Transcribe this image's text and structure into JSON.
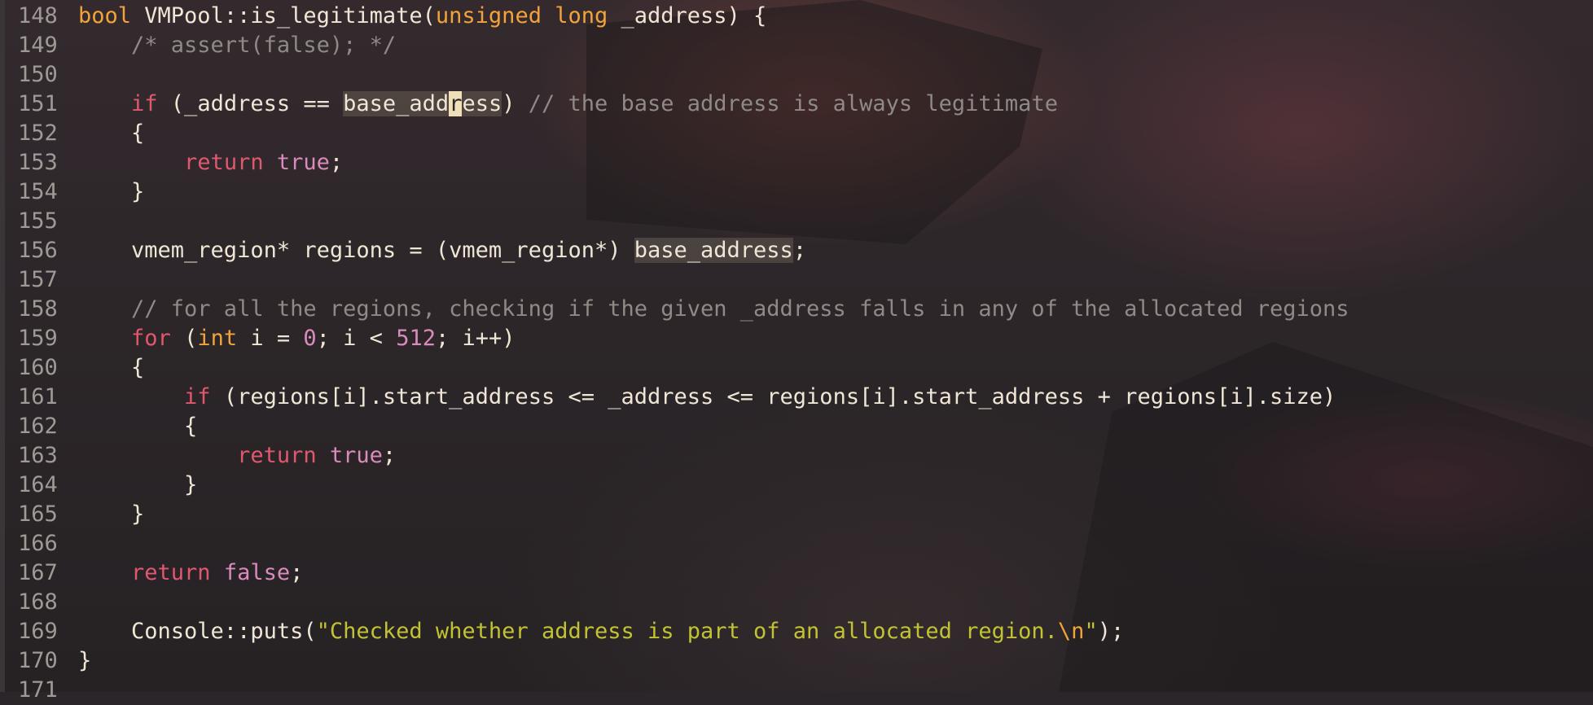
{
  "editor": {
    "lines": [
      {
        "n": "148",
        "tokens": [
          {
            "t": "bool",
            "c": "kw"
          },
          {
            "t": " VMPool::is_legitimate(",
            "c": "pl"
          },
          {
            "t": "unsigned",
            "c": "kw"
          },
          {
            "t": " ",
            "c": "pl"
          },
          {
            "t": "long",
            "c": "kw"
          },
          {
            "t": " _address) {",
            "c": "pl"
          }
        ]
      },
      {
        "n": "149",
        "tokens": [
          {
            "t": "    /* assert(false); */",
            "c": "cm"
          }
        ]
      },
      {
        "n": "150",
        "tokens": []
      },
      {
        "n": "151",
        "tokens": [
          {
            "t": "    ",
            "c": "pl"
          },
          {
            "t": "if",
            "c": "kw2"
          },
          {
            "t": " (_address == ",
            "c": "pl"
          },
          {
            "t": "base_add",
            "c": "pl hl"
          },
          {
            "t": "r",
            "c": "cursor"
          },
          {
            "t": "ess",
            "c": "pl hl"
          },
          {
            "t": ") ",
            "c": "pl"
          },
          {
            "t": "// the base address is always legitimate",
            "c": "cm"
          }
        ]
      },
      {
        "n": "152",
        "tokens": [
          {
            "t": "    {",
            "c": "pl"
          }
        ]
      },
      {
        "n": "153",
        "tokens": [
          {
            "t": "        ",
            "c": "pl"
          },
          {
            "t": "return",
            "c": "kw2"
          },
          {
            "t": " ",
            "c": "pl"
          },
          {
            "t": "true",
            "c": "bool"
          },
          {
            "t": ";",
            "c": "pl"
          }
        ]
      },
      {
        "n": "154",
        "tokens": [
          {
            "t": "    }",
            "c": "pl"
          }
        ]
      },
      {
        "n": "155",
        "tokens": []
      },
      {
        "n": "156",
        "tokens": [
          {
            "t": "    vmem_region* regions = (vmem_region*) ",
            "c": "pl"
          },
          {
            "t": "base_address",
            "c": "pl hl"
          },
          {
            "t": ";",
            "c": "pl"
          }
        ]
      },
      {
        "n": "157",
        "tokens": []
      },
      {
        "n": "158",
        "tokens": [
          {
            "t": "    // for all the regions, checking if the given _address falls in any of the allocated regions",
            "c": "cm"
          }
        ]
      },
      {
        "n": "159",
        "tokens": [
          {
            "t": "    ",
            "c": "pl"
          },
          {
            "t": "for",
            "c": "kw2"
          },
          {
            "t": " (",
            "c": "pl"
          },
          {
            "t": "int",
            "c": "ty"
          },
          {
            "t": " i = ",
            "c": "pl"
          },
          {
            "t": "0",
            "c": "num"
          },
          {
            "t": "; i < ",
            "c": "pl"
          },
          {
            "t": "512",
            "c": "num"
          },
          {
            "t": "; i++)",
            "c": "pl"
          }
        ]
      },
      {
        "n": "160",
        "tokens": [
          {
            "t": "    {",
            "c": "pl"
          }
        ]
      },
      {
        "n": "161",
        "tokens": [
          {
            "t": "        ",
            "c": "pl"
          },
          {
            "t": "if",
            "c": "kw2"
          },
          {
            "t": " (regions[i].start_address <= _address <= regions[i].start_address + regions[i].size)",
            "c": "pl"
          }
        ]
      },
      {
        "n": "162",
        "tokens": [
          {
            "t": "        {",
            "c": "pl"
          }
        ]
      },
      {
        "n": "163",
        "tokens": [
          {
            "t": "            ",
            "c": "pl"
          },
          {
            "t": "return",
            "c": "kw2"
          },
          {
            "t": " ",
            "c": "pl"
          },
          {
            "t": "true",
            "c": "bool"
          },
          {
            "t": ";",
            "c": "pl"
          }
        ]
      },
      {
        "n": "164",
        "tokens": [
          {
            "t": "        }",
            "c": "pl"
          }
        ]
      },
      {
        "n": "165",
        "tokens": [
          {
            "t": "    }",
            "c": "pl"
          }
        ]
      },
      {
        "n": "166",
        "tokens": []
      },
      {
        "n": "167",
        "tokens": [
          {
            "t": "    ",
            "c": "pl"
          },
          {
            "t": "return",
            "c": "kw2"
          },
          {
            "t": " ",
            "c": "pl"
          },
          {
            "t": "false",
            "c": "bool"
          },
          {
            "t": ";",
            "c": "pl"
          }
        ]
      },
      {
        "n": "168",
        "tokens": []
      },
      {
        "n": "169",
        "tokens": [
          {
            "t": "    Console::puts(",
            "c": "pl"
          },
          {
            "t": "\"Checked whether address is part of an allocated region.",
            "c": "str"
          },
          {
            "t": "\\n",
            "c": "esc"
          },
          {
            "t": "\"",
            "c": "str"
          },
          {
            "t": ");",
            "c": "pl"
          }
        ]
      },
      {
        "n": "170",
        "tokens": [
          {
            "t": "}",
            "c": "pl"
          }
        ]
      },
      {
        "n": "171",
        "tokens": []
      }
    ]
  },
  "colors": {
    "keyword": "#f2a33a",
    "control": "#e0586f",
    "literal": "#d98bbb",
    "comment": "#8f8a86",
    "string": "#c2c233",
    "text": "#efe6d6",
    "line_number": "#9e9a96"
  }
}
